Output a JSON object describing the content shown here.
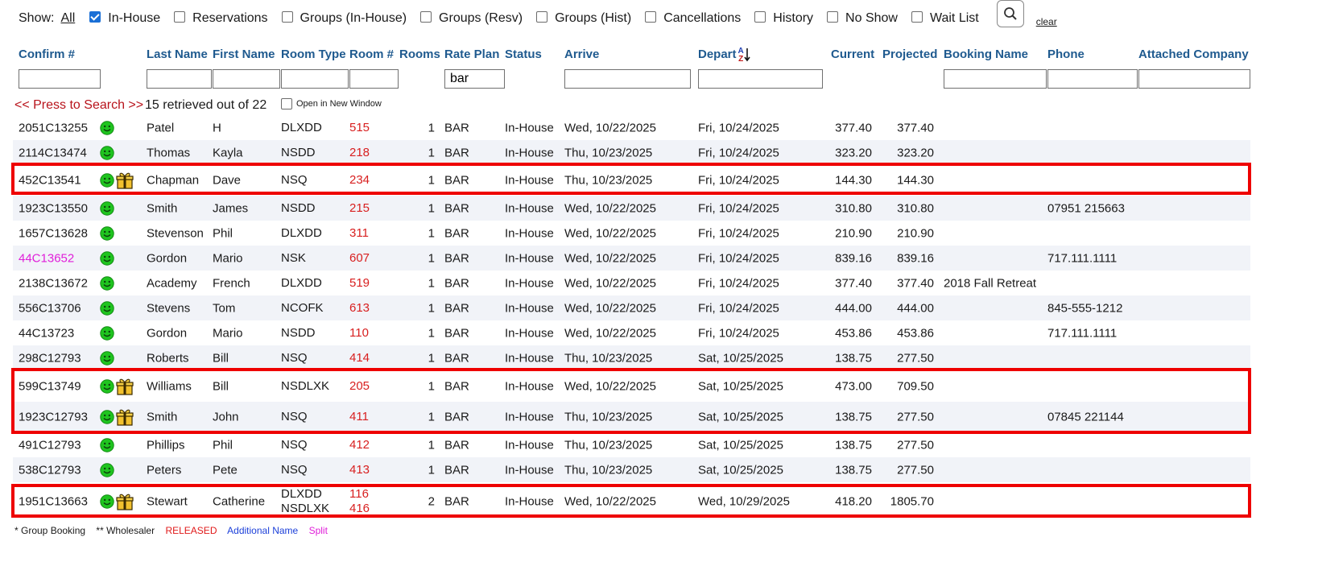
{
  "filters": {
    "show_label": "Show:",
    "all_label": "All",
    "options": [
      {
        "label": "In-House",
        "checked": true
      },
      {
        "label": "Reservations",
        "checked": false
      },
      {
        "label": "Groups (In-House)",
        "checked": false
      },
      {
        "label": "Groups (Resv)",
        "checked": false
      },
      {
        "label": "Groups (Hist)",
        "checked": false
      },
      {
        "label": "Cancellations",
        "checked": false
      },
      {
        "label": "History",
        "checked": false
      },
      {
        "label": "No Show",
        "checked": false
      },
      {
        "label": "Wait List",
        "checked": false
      }
    ],
    "search_icon": "search-icon",
    "clear_label": "clear"
  },
  "columns": {
    "confirm": "Confirm #",
    "last": "Last Name",
    "first": "First Name",
    "roomtype": "Room Type",
    "roomnum": "Room #",
    "rooms": "Rooms",
    "rateplan": "Rate Plan",
    "status": "Status",
    "arrive": "Arrive",
    "depart": "Depart",
    "current": "Current",
    "projected": "Projected",
    "booking": "Booking Name",
    "phone": "Phone",
    "company": "Attached Company"
  },
  "sort_indicator": {
    "top": "A",
    "bottom": "Z",
    "icon": "sort-desc-icon"
  },
  "filter_values": {
    "rateplan": "bar"
  },
  "search": {
    "press_label": "<< Press to Search >>",
    "retrieved_text": "15 retrieved out of 22",
    "new_window_label": "Open in New Window"
  },
  "colors": {
    "header": "#1f5a8f",
    "room": "#d81f1f",
    "released": "#e01919",
    "additional": "#1b3fd9",
    "split": "#e01ed9",
    "highlight": "#ee0000"
  },
  "rows": [
    {
      "confirm": "2051C13255",
      "gift": false,
      "split": false,
      "last": "Patel",
      "first": "H",
      "roomtype": [
        "DLXDD"
      ],
      "room": [
        "515"
      ],
      "rooms": "1",
      "rate": "BAR",
      "status": "In-House",
      "arrive": "Wed, 10/22/2025",
      "depart": "Fri, 10/24/2025",
      "current": "377.40",
      "projected": "377.40",
      "booking": "",
      "phone": "",
      "highlight": false
    },
    {
      "confirm": "2114C13474",
      "gift": false,
      "split": false,
      "last": "Thomas",
      "first": "Kayla",
      "roomtype": [
        "NSDD"
      ],
      "room": [
        "218"
      ],
      "rooms": "1",
      "rate": "BAR",
      "status": "In-House",
      "arrive": "Thu, 10/23/2025",
      "depart": "Fri, 10/24/2025",
      "current": "323.20",
      "projected": "323.20",
      "booking": "",
      "phone": "",
      "highlight": false
    },
    {
      "confirm": "452C13541",
      "gift": true,
      "split": false,
      "last": "Chapman",
      "first": "Dave",
      "roomtype": [
        "NSQ"
      ],
      "room": [
        "234"
      ],
      "rooms": "1",
      "rate": "BAR",
      "status": "In-House",
      "arrive": "Thu, 10/23/2025",
      "depart": "Fri, 10/24/2025",
      "current": "144.30",
      "projected": "144.30",
      "booking": "",
      "phone": "",
      "highlight": true
    },
    {
      "confirm": "1923C13550",
      "gift": false,
      "split": false,
      "last": "Smith",
      "first": "James",
      "roomtype": [
        "NSDD"
      ],
      "room": [
        "215"
      ],
      "rooms": "1",
      "rate": "BAR",
      "status": "In-House",
      "arrive": "Wed, 10/22/2025",
      "depart": "Fri, 10/24/2025",
      "current": "310.80",
      "projected": "310.80",
      "booking": "",
      "phone": "07951 215663",
      "highlight": false
    },
    {
      "confirm": "1657C13628",
      "gift": false,
      "split": false,
      "last": "Stevenson",
      "first": "Phil",
      "roomtype": [
        "DLXDD"
      ],
      "room": [
        "311"
      ],
      "rooms": "1",
      "rate": "BAR",
      "status": "In-House",
      "arrive": "Wed, 10/22/2025",
      "depart": "Fri, 10/24/2025",
      "current": "210.90",
      "projected": "210.90",
      "booking": "",
      "phone": "",
      "highlight": false
    },
    {
      "confirm": "44C13652",
      "gift": false,
      "split": true,
      "last": "Gordon",
      "first": "Mario",
      "roomtype": [
        "NSK"
      ],
      "room": [
        "607"
      ],
      "rooms": "1",
      "rate": "BAR",
      "status": "In-House",
      "arrive": "Wed, 10/22/2025",
      "depart": "Fri, 10/24/2025",
      "current": "839.16",
      "projected": "839.16",
      "booking": "",
      "phone": "717.111.1111",
      "highlight": false
    },
    {
      "confirm": "2138C13672",
      "gift": false,
      "split": false,
      "last": "Academy",
      "first": "French",
      "roomtype": [
        "DLXDD"
      ],
      "room": [
        "519"
      ],
      "rooms": "1",
      "rate": "BAR",
      "status": "In-House",
      "arrive": "Wed, 10/22/2025",
      "depart": "Fri, 10/24/2025",
      "current": "377.40",
      "projected": "377.40",
      "booking": "2018 Fall Retreat",
      "phone": "",
      "highlight": false
    },
    {
      "confirm": "556C13706",
      "gift": false,
      "split": false,
      "last": "Stevens",
      "first": "Tom",
      "roomtype": [
        "NCOFK"
      ],
      "room": [
        "613"
      ],
      "rooms": "1",
      "rate": "BAR",
      "status": "In-House",
      "arrive": "Wed, 10/22/2025",
      "depart": "Fri, 10/24/2025",
      "current": "444.00",
      "projected": "444.00",
      "booking": "",
      "phone": "845-555-1212",
      "highlight": false
    },
    {
      "confirm": "44C13723",
      "gift": false,
      "split": false,
      "last": "Gordon",
      "first": "Mario",
      "roomtype": [
        "NSDD"
      ],
      "room": [
        "110"
      ],
      "rooms": "1",
      "rate": "BAR",
      "status": "In-House",
      "arrive": "Wed, 10/22/2025",
      "depart": "Fri, 10/24/2025",
      "current": "453.86",
      "projected": "453.86",
      "booking": "",
      "phone": "717.111.1111",
      "highlight": false
    },
    {
      "confirm": "298C12793",
      "gift": false,
      "split": false,
      "last": "Roberts",
      "first": "Bill",
      "roomtype": [
        "NSQ"
      ],
      "room": [
        "414"
      ],
      "rooms": "1",
      "rate": "BAR",
      "status": "In-House",
      "arrive": "Thu, 10/23/2025",
      "depart": "Sat, 10/25/2025",
      "current": "138.75",
      "projected": "277.50",
      "booking": "",
      "phone": "",
      "highlight": false
    },
    {
      "confirm": "599C13749",
      "gift": true,
      "split": false,
      "last": "Williams",
      "first": "Bill",
      "roomtype": [
        "NSDLXK"
      ],
      "room": [
        "205"
      ],
      "rooms": "1",
      "rate": "BAR",
      "status": "In-House",
      "arrive": "Wed, 10/22/2025",
      "depart": "Sat, 10/25/2025",
      "current": "473.00",
      "projected": "709.50",
      "booking": "",
      "phone": "",
      "highlight": true
    },
    {
      "confirm": "1923C12793",
      "gift": true,
      "split": false,
      "last": "Smith",
      "first": "John",
      "roomtype": [
        "NSQ"
      ],
      "room": [
        "411"
      ],
      "rooms": "1",
      "rate": "BAR",
      "status": "In-House",
      "arrive": "Thu, 10/23/2025",
      "depart": "Sat, 10/25/2025",
      "current": "138.75",
      "projected": "277.50",
      "booking": "",
      "phone": "07845 221144",
      "highlight": true
    },
    {
      "confirm": "491C12793",
      "gift": false,
      "split": false,
      "last": "Phillips",
      "first": "Phil",
      "roomtype": [
        "NSQ"
      ],
      "room": [
        "412"
      ],
      "rooms": "1",
      "rate": "BAR",
      "status": "In-House",
      "arrive": "Thu, 10/23/2025",
      "depart": "Sat, 10/25/2025",
      "current": "138.75",
      "projected": "277.50",
      "booking": "",
      "phone": "",
      "highlight": false
    },
    {
      "confirm": "538C12793",
      "gift": false,
      "split": false,
      "last": "Peters",
      "first": "Pete",
      "roomtype": [
        "NSQ"
      ],
      "room": [
        "413"
      ],
      "rooms": "1",
      "rate": "BAR",
      "status": "In-House",
      "arrive": "Thu, 10/23/2025",
      "depart": "Sat, 10/25/2025",
      "current": "138.75",
      "projected": "277.50",
      "booking": "",
      "phone": "",
      "highlight": false
    },
    {
      "confirm": "1951C13663",
      "gift": true,
      "split": false,
      "last": "Stewart",
      "first": "Catherine",
      "roomtype": [
        "DLXDD",
        "NSDLXK"
      ],
      "room": [
        "116",
        "416"
      ],
      "rooms": "2",
      "rate": "BAR",
      "status": "In-House",
      "arrive": "Wed, 10/22/2025",
      "depart": "Wed, 10/29/2025",
      "current": "418.20",
      "projected": "1805.70",
      "booking": "",
      "phone": "",
      "highlight": true
    }
  ],
  "legend": {
    "group": "* Group Booking",
    "wholesaler": "** Wholesaler",
    "released": "RELEASED",
    "additional": "Additional Name",
    "split": "Split"
  }
}
